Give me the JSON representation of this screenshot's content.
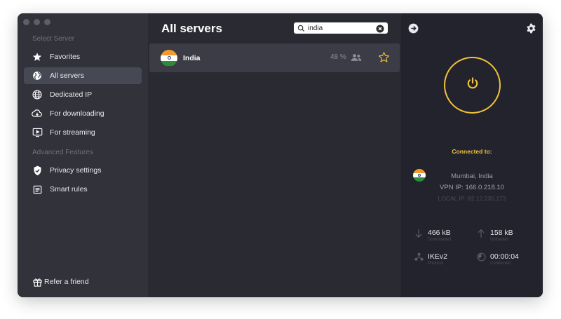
{
  "sidebar": {
    "section_select": "Select Server",
    "items": [
      {
        "label": "Favorites",
        "icon": "star-icon"
      },
      {
        "label": "All servers",
        "icon": "globe-icon"
      },
      {
        "label": "Dedicated IP",
        "icon": "globe-network-icon"
      },
      {
        "label": "For downloading",
        "icon": "cloud-download-icon"
      },
      {
        "label": "For streaming",
        "icon": "play-screen-icon"
      }
    ],
    "section_advanced": "Advanced Features",
    "advanced_items": [
      {
        "label": "Privacy settings",
        "icon": "shield-icon"
      },
      {
        "label": "Smart rules",
        "icon": "rules-list-icon"
      }
    ],
    "refer_label": "Refer a friend"
  },
  "main": {
    "title": "All servers",
    "search": {
      "value": "india",
      "placeholder": ""
    },
    "servers": [
      {
        "name": "India",
        "load": "48 %"
      }
    ]
  },
  "status": {
    "connected_label": "Connected to:",
    "location": "Mumbai, India",
    "vpn_ip": "VPN IP: 166.0.218.10",
    "local_ip": "LOCAL IP: 82.12.235.173",
    "downloaded_value": "466 kB",
    "downloaded_label": "Downloaded",
    "uploaded_value": "158 kB",
    "uploaded_label": "Uploaded",
    "protocol_value": "IKEv2",
    "protocol_label": "Protocol",
    "time_value": "00:00:04",
    "time_label": "Connected"
  },
  "colors": {
    "accent": "#f2c23a",
    "sidebar_bg": "#31323a",
    "main_bg": "#2a2b32",
    "panel_bg": "#22232d"
  }
}
